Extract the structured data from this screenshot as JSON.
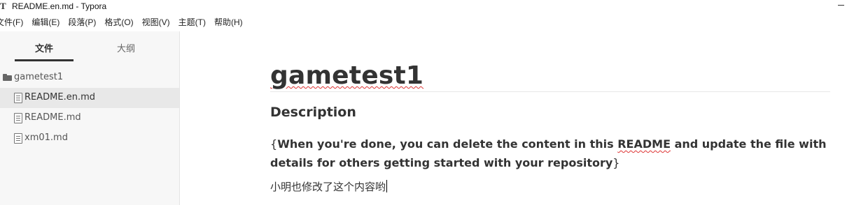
{
  "window": {
    "app_icon": "T",
    "title": "README.en.md - Typora",
    "minimize_icon": "minimize-icon"
  },
  "menu": [
    "文件(F)",
    "编辑(E)",
    "段落(P)",
    "格式(O)",
    "视图(V)",
    "主题(T)",
    "帮助(H)"
  ],
  "sidebar": {
    "tabs": [
      {
        "label": "文件",
        "active": true
      },
      {
        "label": "大纲",
        "active": false
      }
    ],
    "folder": {
      "label": "gametest1",
      "icon": "folder-icon"
    },
    "files": [
      {
        "label": "README.en.md",
        "icon": "file-icon",
        "active": true
      },
      {
        "label": "README.md",
        "icon": "file-icon",
        "active": false
      },
      {
        "label": "xm01.md",
        "icon": "file-icon",
        "active": false
      }
    ]
  },
  "document": {
    "title": "gametest1",
    "heading": "Description",
    "para_open_brace": "{",
    "para_text_1": "When you're done, you can delete the content in this ",
    "para_text_link": "README",
    "para_text_2": " and update the file with details for others getting started with your repository",
    "para_close_brace": "}",
    "para2": "小明也修改了这个内容哟"
  }
}
